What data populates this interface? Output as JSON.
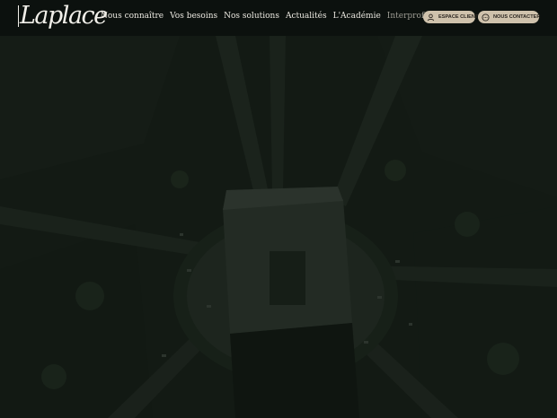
{
  "brand": {
    "logo_text": "Laplace"
  },
  "nav": {
    "items": [
      {
        "label": "Nous connaître"
      },
      {
        "label": "Vos besoins"
      },
      {
        "label": "Nos solutions"
      },
      {
        "label": "Actualités"
      },
      {
        "label": "L'Académie"
      },
      {
        "label": "Interprofessionnalité"
      }
    ]
  },
  "header_buttons": {
    "client_label": "ESPACE CLIENT",
    "contact_label": "NOUS CONTACTER"
  },
  "colors": {
    "overlay": "#121813",
    "nav_text": "#ece9e1",
    "nav_muted": "#9d9c93",
    "button_bg": "#cfc2ac",
    "button_text": "#2b2620"
  },
  "icons": {
    "client": "user-icon",
    "contact": "chat-bubble-icon"
  }
}
